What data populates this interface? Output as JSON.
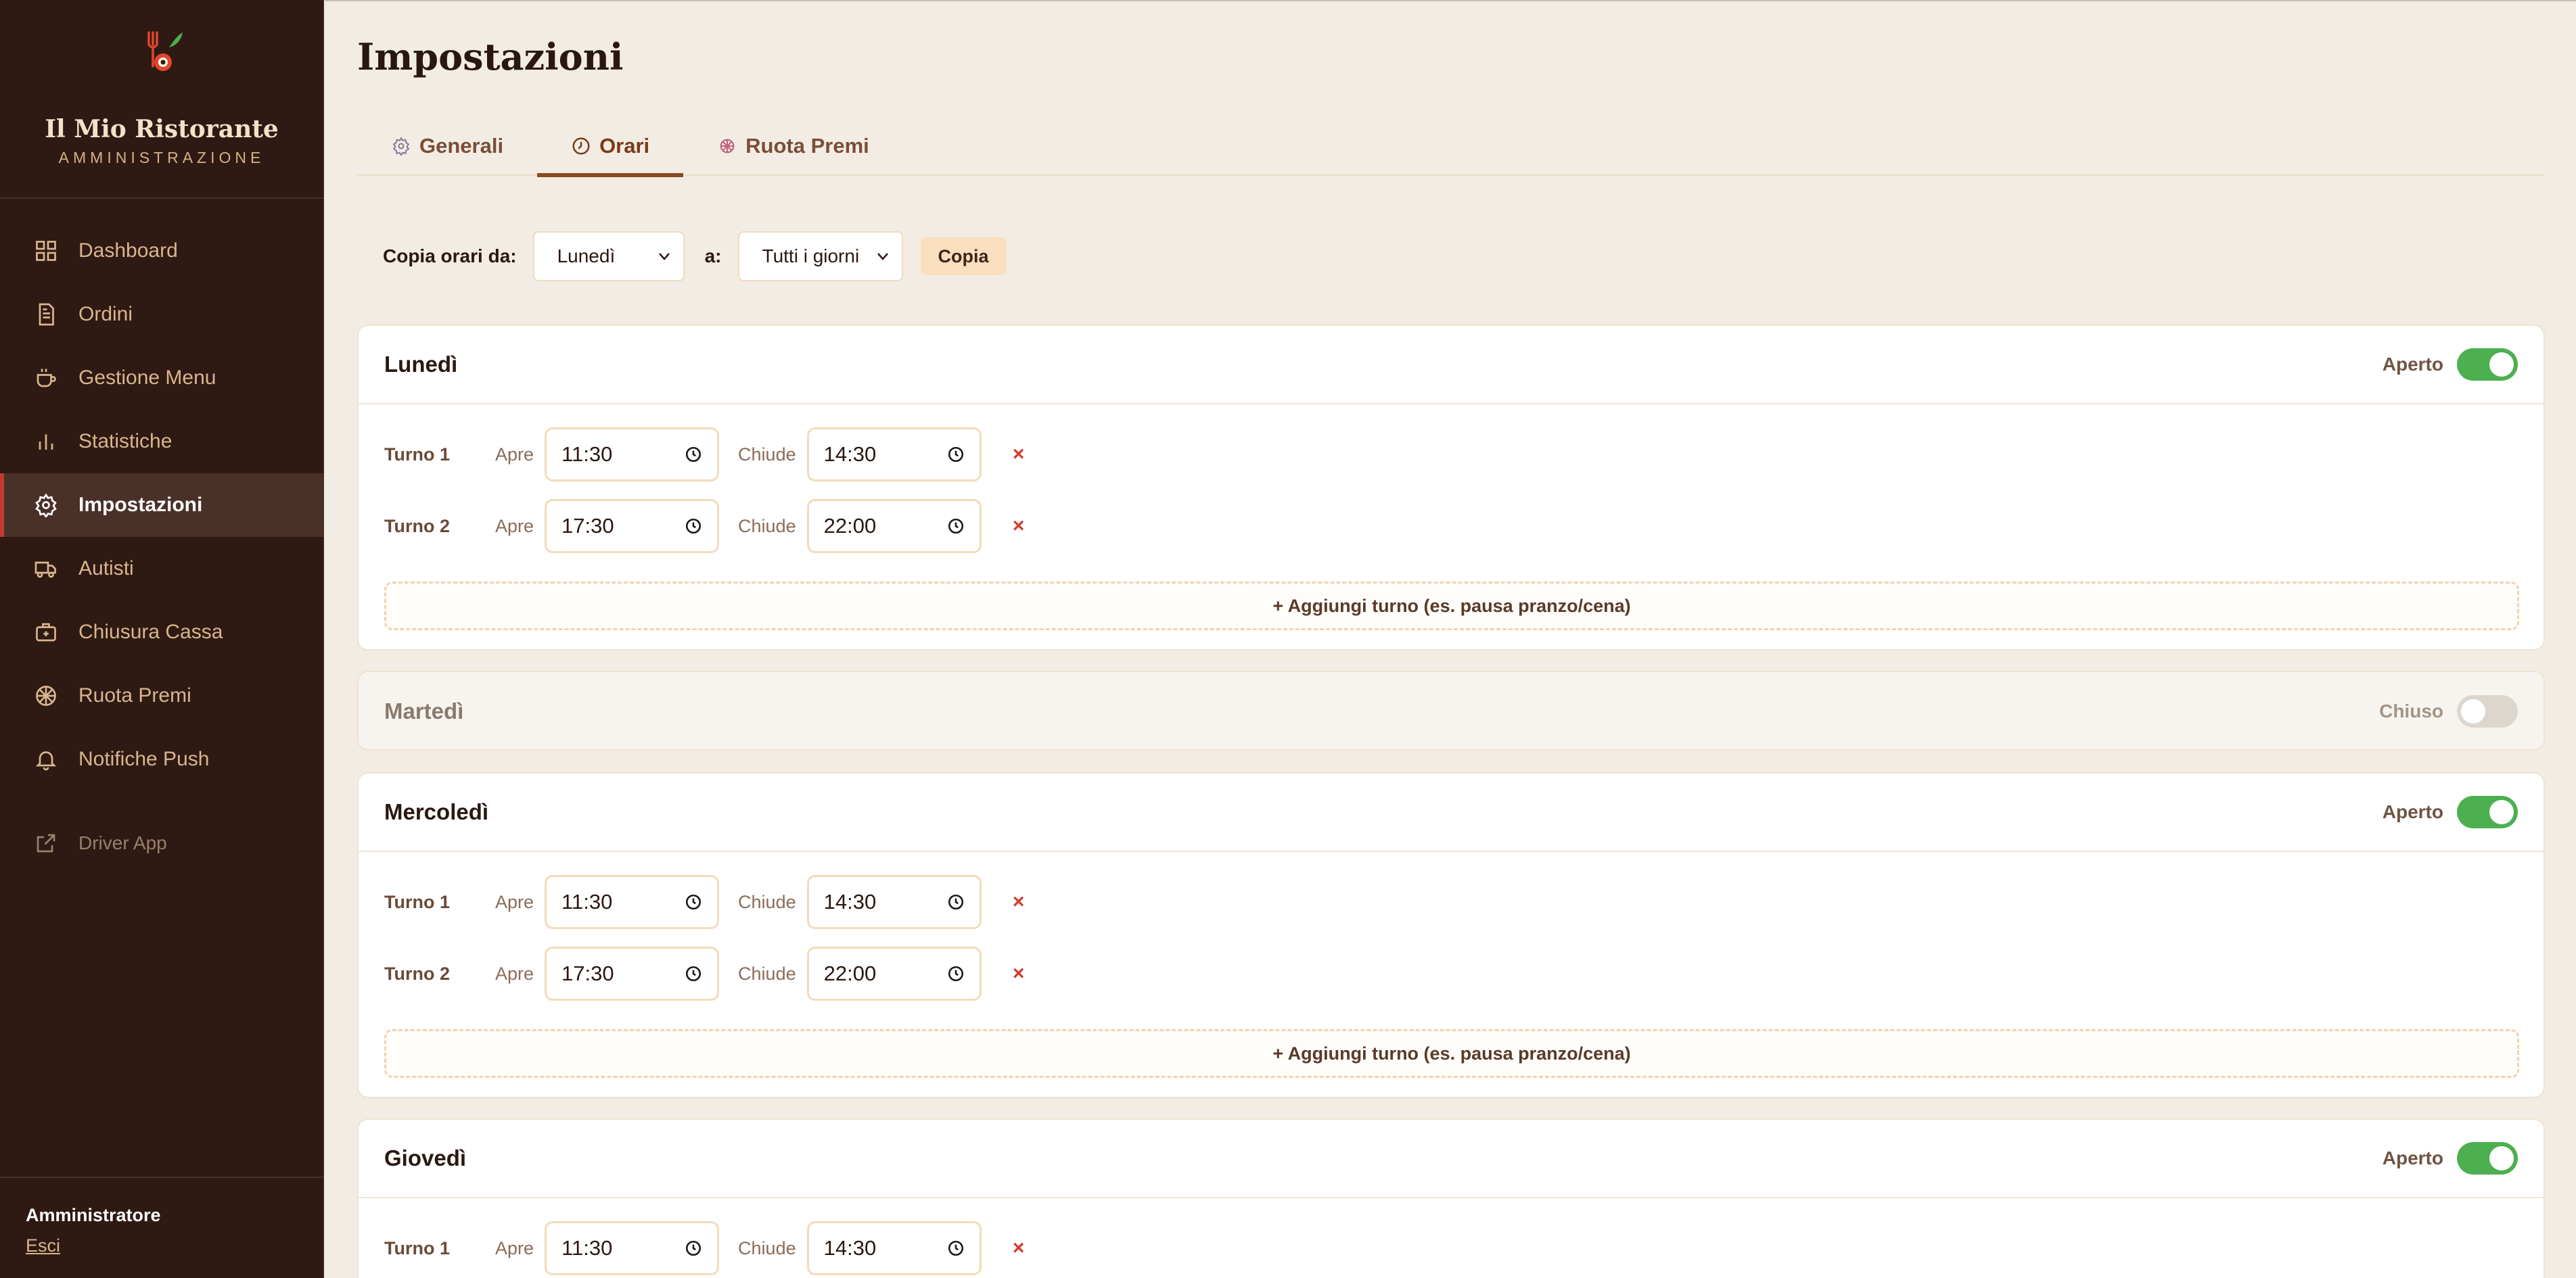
{
  "sidebar": {
    "brand_name": "Il Mio Ristorante",
    "brand_sub": "AMMINISTRAZIONE",
    "items": [
      {
        "label": "Dashboard",
        "icon": "grid-icon"
      },
      {
        "label": "Ordini",
        "icon": "document-icon"
      },
      {
        "label": "Gestione Menu",
        "icon": "coffee-cup-icon"
      },
      {
        "label": "Statistiche",
        "icon": "bar-chart-icon"
      },
      {
        "label": "Impostazioni",
        "icon": "gear-icon"
      },
      {
        "label": "Autisti",
        "icon": "truck-icon"
      },
      {
        "label": "Chiusura Cassa",
        "icon": "cash-register-icon"
      },
      {
        "label": "Ruota Premi",
        "icon": "wheel-icon"
      },
      {
        "label": "Notifiche Push",
        "icon": "bell-icon"
      }
    ],
    "active_item": "Impostazioni",
    "driver_app": "Driver App",
    "user": "Amministratore",
    "logout": "Esci"
  },
  "main": {
    "title": "Impostazioni",
    "tabs": [
      {
        "label": "Generali",
        "icon": "gear-icon"
      },
      {
        "label": "Orari",
        "icon": "clock-icon"
      },
      {
        "label": "Ruota Premi",
        "icon": "wheel-icon"
      }
    ],
    "active_tab": "Orari",
    "copy": {
      "from_label": "Copia orari da:",
      "from_value": "Lunedì",
      "to_label": "a:",
      "to_value": "Tutti i giorni",
      "button": "Copia"
    },
    "labels": {
      "open": "Apre",
      "close": "Chiude",
      "add_shift": "+ Aggiungi turno (es. pausa pranzo/cena)",
      "remove": "×"
    },
    "days": [
      {
        "name": "Lunedì",
        "status": "Aperto",
        "shifts": [
          {
            "label": "Turno 1",
            "open": "11:30",
            "close": "14:30"
          },
          {
            "label": "Turno 2",
            "open": "17:30",
            "close": "22:00"
          }
        ]
      },
      {
        "name": "Martedì",
        "status": "Chiuso",
        "shifts": []
      },
      {
        "name": "Mercoledì",
        "status": "Aperto",
        "shifts": [
          {
            "label": "Turno 1",
            "open": "11:30",
            "close": "14:30"
          },
          {
            "label": "Turno 2",
            "open": "17:30",
            "close": "22:00"
          }
        ]
      },
      {
        "name": "Giovedì",
        "status": "Aperto",
        "shifts": [
          {
            "label": "Turno 1",
            "open": "11:30",
            "close": "14:30"
          }
        ]
      }
    ]
  },
  "colors": {
    "sidebar_bg": "#2e1a13",
    "accent": "#8a4a22",
    "toggle_on": "#4caf50",
    "remove": "#d23a2f"
  }
}
